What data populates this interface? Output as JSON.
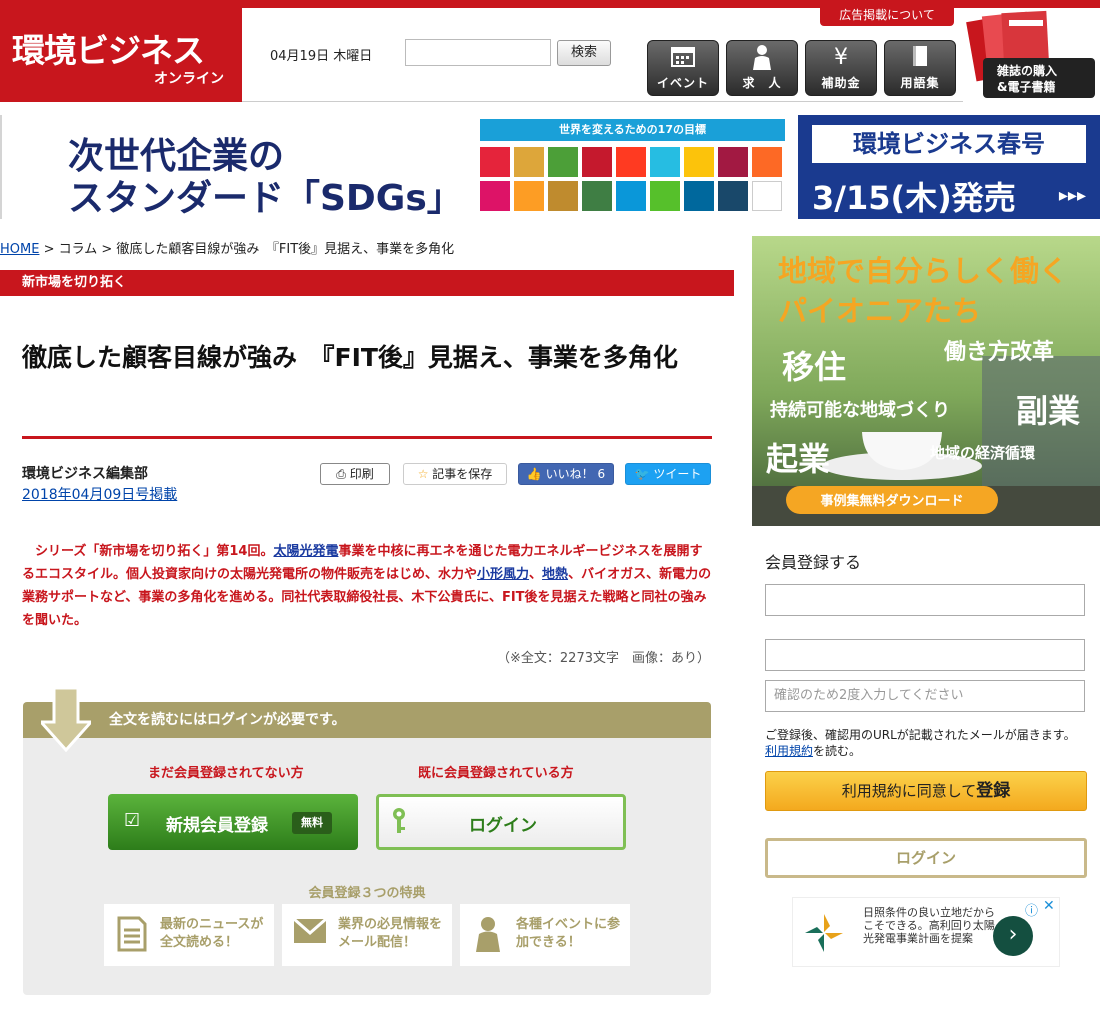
{
  "header": {
    "logo_main": "環境ビジネス",
    "logo_sub": "オンライン",
    "date": "04月19日 木曜日",
    "search_label": "検索",
    "ad_link": "広告掲載について",
    "nav": [
      {
        "label": "イベント",
        "icon": "calendar-icon"
      },
      {
        "label": "求　人",
        "icon": "person-icon"
      },
      {
        "label": "補助金",
        "icon": "yen-icon"
      },
      {
        "label": "用語集",
        "icon": "book-icon"
      }
    ],
    "magazine_label_1": "雑誌の購入",
    "magazine_label_2": "&電子書籍"
  },
  "banner": {
    "line1": "次世代企業の",
    "line2": "スタンダード「SDGs」",
    "sdg_header": "世界を変えるための17の目標",
    "spring_title": "環境ビジネス春号",
    "spring_date": "3/15(木)発売",
    "spring_arrow": "▸▸▸"
  },
  "breadcrumb": {
    "home": "HOME",
    "sep1": " > ",
    "column": "コラム",
    "sep2": " > ",
    "current": "徹底した顧客目線が強み　『FIT後』見据え、事業を多角化"
  },
  "article": {
    "category": "新市場を切り拓く",
    "title": "徹底した顧客目線が強み　『FIT後』見据え、事業を多角化",
    "author": "環境ビジネス編集部",
    "pubdate": "2018年04月09日号掲載",
    "print": "印刷",
    "save": "記事を保存",
    "like": "いいね！ 6",
    "tweet": "ツイート",
    "lead_1": "　シリーズ「新市場を切り拓く」第14回。",
    "lead_link_1": "太陽光発電",
    "lead_2": "事業を中核に再エネを通じた電力エネルギービジネスを展開するエコスタイル。個人投資家向けの太陽光発電所の物件販売をはじめ、水力や",
    "lead_link_2": "小形風力",
    "lead_3": "、",
    "lead_link_3": "地熱",
    "lead_4": "、バイオガス、新電力の業務サポートなど、事業の多角化を進める。同社代表取締役社長、木下公貴氏に、FIT後を見据えた戦略と同社の強みを聞いた。",
    "wordcount": "（※全文：2273文字　画像：あり）"
  },
  "login_box": {
    "header": "全文を読むにはログインが必要です。",
    "new_label": "まだ会員登録されてない方",
    "existing_label": "既に会員登録されている方",
    "register_btn": "新規会員登録",
    "free_badge": "無料",
    "login_btn": "ログイン",
    "benefit_title": "会員登録３つの特典",
    "benefits": [
      {
        "text": "最新のニュースが全文読める！"
      },
      {
        "text": "業界の必見情報をメール配信！"
      },
      {
        "text": "各種イベントに参加できる！"
      }
    ]
  },
  "sidebar": {
    "img_title_1": "地域で自分らしく働く",
    "img_title_2": "パイオニアたち",
    "img_w1": "移住",
    "img_w2": "働き方改革",
    "img_w3": "持続可能な地域づくり",
    "img_w4": "副業",
    "img_w5": "起業",
    "img_w6": "地域の経済循環",
    "img_cta": "事例集無料ダウンロード",
    "signup_title": "会員登録する",
    "confirm_placeholder": "確認のため2度入力してください",
    "note": "ご登録後、確認用のURLが記載されたメールが届きます。",
    "terms_link": "利用規約",
    "terms_suffix": "を読む。",
    "agree_prefix": "利用規約に同意して",
    "agree_strong": "登録",
    "login_btn": "ログイン",
    "ad_text": "日照条件の良い立地だからこそできる。高利回り太陽光発電事業計画を提案",
    "ad_go": "›"
  },
  "colors": {
    "brand_red": "#c8161d",
    "gold": "#a89f6a",
    "green": "#2d7d1a"
  }
}
